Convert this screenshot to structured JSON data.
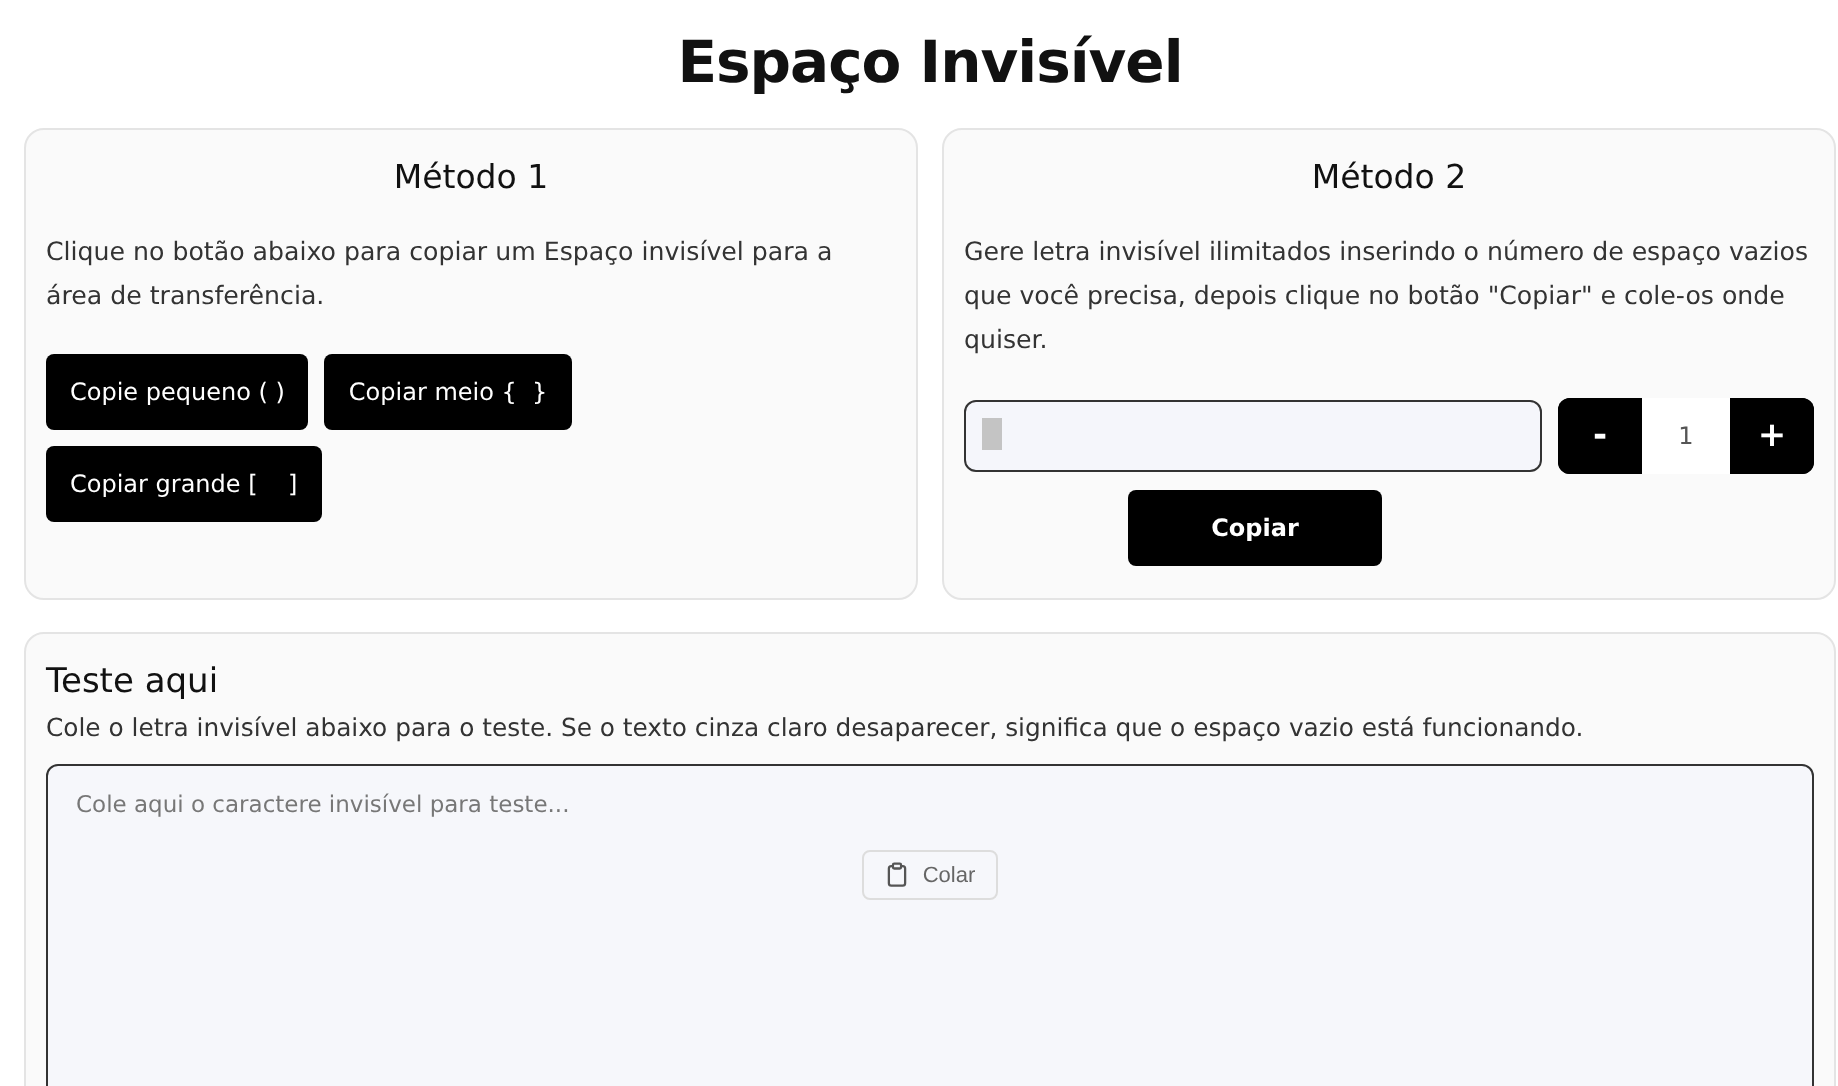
{
  "title": "Espaço Invisível",
  "method1": {
    "heading": "Método 1",
    "description": "Clique no botão abaixo para copiar um Espaço invisível para a área de transferência.",
    "buttons": [
      "Copie pequeno ( )",
      "Copiar meio {  }",
      "Copiar grande [    ]"
    ]
  },
  "method2": {
    "heading": "Método 2",
    "description": "Gere letra invisível ilimitados inserindo o número de espaço vazios que você precisa, depois clique no botão \"Copiar\" e cole-os onde quiser.",
    "minus": "-",
    "count": "1",
    "plus": "+",
    "copy_button": "Copiar"
  },
  "test": {
    "heading": "Teste aqui",
    "description": "Cole o letra invisível abaixo para o teste. Se o texto cinza claro desaparecer, significa que o espaço vazio está funcionando.",
    "placeholder": "Cole aqui o caractere invisível para teste...",
    "paste_button": "Colar"
  }
}
